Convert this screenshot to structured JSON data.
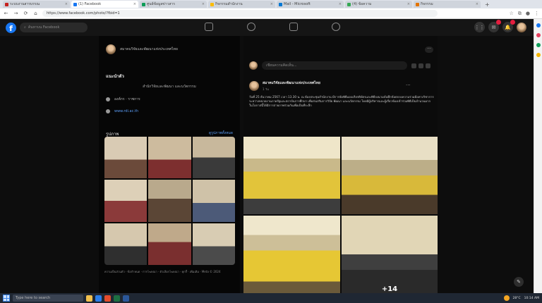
{
  "browser": {
    "tabs": [
      {
        "label": "ระบบงานสารบรรณ",
        "color": "#c5221f"
      },
      {
        "label": "(1) Facebook",
        "color": "#1877f2",
        "active": true
      },
      {
        "label": "ศูนย์ข้อมูลข่าวสาร",
        "color": "#0f9d58"
      },
      {
        "label": "กิจกรรมสำนักงาน",
        "color": "#fbbc05"
      },
      {
        "label": "Mail - Microsoft",
        "color": "#0078d4"
      },
      {
        "label": "(4) ข้อความ",
        "color": "#34a853"
      },
      {
        "label": "กิจกรรม",
        "color": "#e37400"
      }
    ],
    "url": "https://www.facebook.com/photo/?fbid=1",
    "new_tab": "+"
  },
  "facebook": {
    "logo": "f",
    "search_placeholder": "ค้นหาบน Facebook",
    "grid_icon": "⋮⋮",
    "messenger_icon": "✉",
    "bell_icon": "🔔"
  },
  "left_panel": {
    "page_name": "สมาคมวิจัยและพัฒนาแห่งประเทศไทย",
    "intro_title": "แนะนำตัว",
    "intro_text": "สำนักวิจัยและพัฒนา และนวัตกรรม",
    "category": "องค์กร · ราชการ",
    "website": "www.rdi.ac.th",
    "photos_title": "รูปภาพ",
    "see_all": "ดูรูปภาพทั้งหมด",
    "footer": "ความเป็นส่วนตัว · ข้อกำหนด · การโฆษณา · ตัวเลือกโฆษณา · คุกกี้ · เพิ่มเติม · Meta © 2024"
  },
  "post": {
    "composer_placeholder": "เขียนความคิดเห็น...",
    "author": "สมาคมวิจัยและพัฒนาแห่งประเทศไทย",
    "time": "1 วัน",
    "body": "วันที่ 25 ธันวาคม 2567 เวลา 13.30 น. ณ ห้องประชุมสำนักงาน มีการจัดพิธีมอบเกียรติบัตรและพิธีลงนามบันทึกข้อตกลงความร่วมมือทางวิชาการ ระหว่างหน่วยงานภาครัฐและสถาบันการศึกษา เพื่อส่งเสริมการวิจัย พัฒนา และนวัตกรรม โดยมีผู้บริหารและผู้เกี่ยวข้องเข้าร่วมพิธีเป็นจำนวนมาก ในโอกาสนี้ได้มีการถ่ายภาพร่วมกันเพื่อเป็นที่ระลึก",
    "more_count": "+14",
    "more_label": "···"
  },
  "taskbar": {
    "search_placeholder": "Type here to search",
    "weather": "28°C",
    "time": "10:14 AM"
  }
}
